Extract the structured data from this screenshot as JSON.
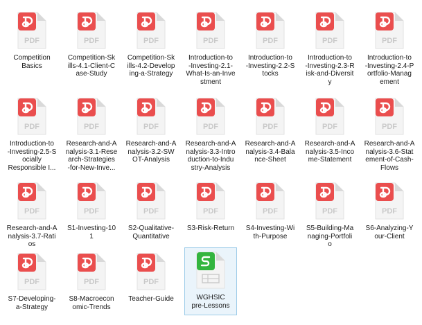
{
  "colors": {
    "pdf_badge": "#ea4e4e",
    "pdf_text": "#c9c9c9",
    "doc_body": "#f4f4f4",
    "doc_fold": "#d9d9d9",
    "sheet_badge": "#33b53f",
    "selection_border": "#9ccbe8",
    "selection_fill": "#eaf4fb"
  },
  "files": [
    {
      "label": "Competition\nBasics",
      "type": "pdf",
      "icon": "pdf-file-icon",
      "badge": "PDF"
    },
    {
      "label": "Competition-Sk\nills-4.1-Client-C\nase-Study",
      "type": "pdf",
      "icon": "pdf-file-icon",
      "badge": "PDF"
    },
    {
      "label": "Competition-Sk\nills-4.2-Develop\ning-a-Strategy",
      "type": "pdf",
      "icon": "pdf-file-icon",
      "badge": "PDF"
    },
    {
      "label": "Introduction-to\n-Investing-2.1-\nWhat-Is-an-Inve\nstment",
      "type": "pdf",
      "icon": "pdf-file-icon",
      "badge": "PDF"
    },
    {
      "label": "Introduction-to\n-Investing-2.2-S\ntocks",
      "type": "pdf",
      "icon": "pdf-file-icon",
      "badge": "PDF"
    },
    {
      "label": "Introduction-to\n-Investing-2.3-R\nisk-and-Diversit\ny",
      "type": "pdf",
      "icon": "pdf-file-icon",
      "badge": "PDF"
    },
    {
      "label": "Introduction-to\n-Investing-2.4-P\nortfolio-Manag\nement",
      "type": "pdf",
      "icon": "pdf-file-icon",
      "badge": "PDF"
    },
    {
      "label": "Introduction-to\n-Investing-2.5-S\nocially\nResponsible I...",
      "type": "pdf",
      "icon": "pdf-file-icon",
      "badge": "PDF"
    },
    {
      "label": "Research-and-A\nnalysis-3.1-Rese\narch-Strategies\n-for-New-Inve...",
      "type": "pdf",
      "icon": "pdf-file-icon",
      "badge": "PDF"
    },
    {
      "label": "Research-and-A\nnalysis-3.2-SW\nOT-Analysis",
      "type": "pdf",
      "icon": "pdf-file-icon",
      "badge": "PDF"
    },
    {
      "label": "Research-and-A\nnalysis-3.3-Intro\nduction-to-Indu\nstry-Analysis",
      "type": "pdf",
      "icon": "pdf-file-icon",
      "badge": "PDF"
    },
    {
      "label": "Research-and-A\nnalysis-3.4-Bala\nnce-Sheet",
      "type": "pdf",
      "icon": "pdf-file-icon",
      "badge": "PDF"
    },
    {
      "label": "Research-and-A\nnalysis-3.5-Inco\nme-Statement",
      "type": "pdf",
      "icon": "pdf-file-icon",
      "badge": "PDF"
    },
    {
      "label": "Research-and-A\nnalysis-3.6-Stat\nement-of-Cash-\nFlows",
      "type": "pdf",
      "icon": "pdf-file-icon",
      "badge": "PDF"
    },
    {
      "label": "Research-and-A\nnalysis-3.7-Rati\nos",
      "type": "pdf",
      "icon": "pdf-file-icon",
      "badge": "PDF"
    },
    {
      "label": "S1-Investing-10\n1",
      "type": "pdf",
      "icon": "pdf-file-icon",
      "badge": "PDF"
    },
    {
      "label": "S2-Qualitative-\nQuantitative",
      "type": "pdf",
      "icon": "pdf-file-icon",
      "badge": "PDF"
    },
    {
      "label": "S3-Risk-Return",
      "type": "pdf",
      "icon": "pdf-file-icon",
      "badge": "PDF"
    },
    {
      "label": "S4-Investing-Wi\nth-Purpose",
      "type": "pdf",
      "icon": "pdf-file-icon",
      "badge": "PDF"
    },
    {
      "label": "S5-Building-Ma\nnaging-Portfoli\no",
      "type": "pdf",
      "icon": "pdf-file-icon",
      "badge": "PDF"
    },
    {
      "label": "S6-Analyzing-Y\nour-Client",
      "type": "pdf",
      "icon": "pdf-file-icon",
      "badge": "PDF"
    },
    {
      "label": "S7-Developing-\na-Strategy",
      "type": "pdf",
      "icon": "pdf-file-icon",
      "badge": "PDF"
    },
    {
      "label": "S8-Macroecon\nomic-Trends",
      "type": "pdf",
      "icon": "pdf-file-icon",
      "badge": "PDF"
    },
    {
      "label": "Teacher-Guide",
      "type": "pdf",
      "icon": "pdf-file-icon",
      "badge": "PDF"
    },
    {
      "label": "WGHSIC\npre-Lessons",
      "type": "sheet",
      "icon": "spreadsheet-file-icon",
      "badge": "",
      "selected": true
    }
  ]
}
